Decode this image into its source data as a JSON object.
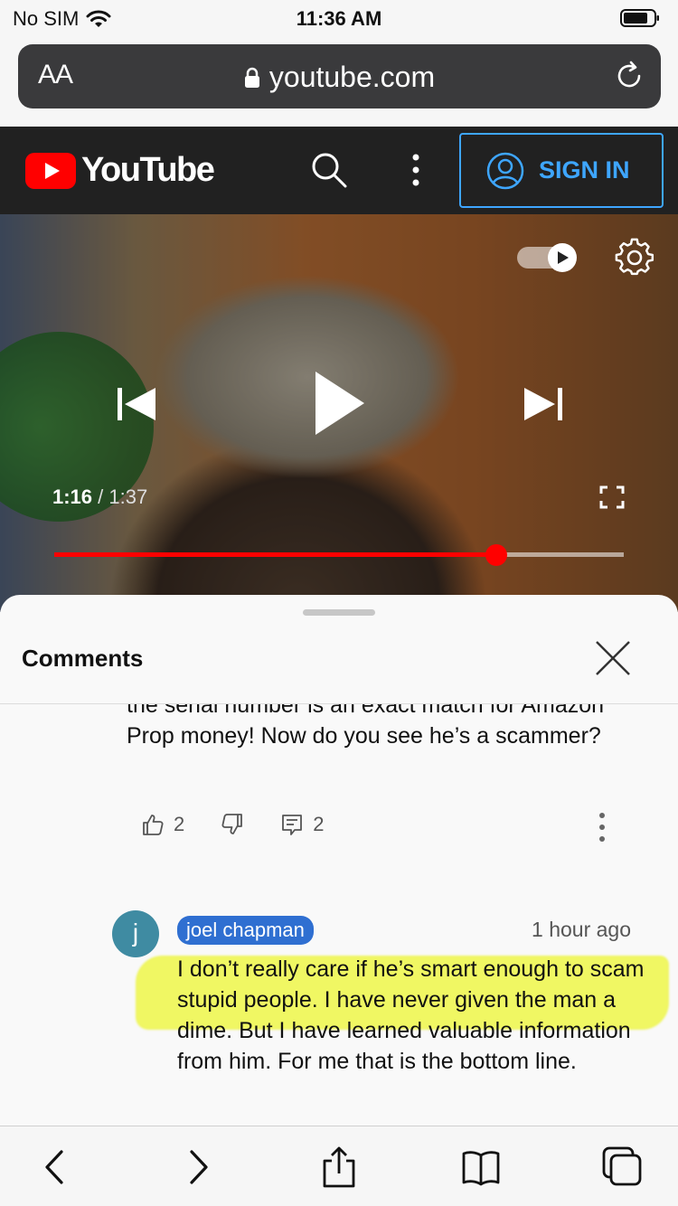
{
  "status_bar": {
    "carrier": "No SIM",
    "time": "11:36 AM"
  },
  "browser": {
    "text_size_label": "AA",
    "url": "youtube.com"
  },
  "header": {
    "logo_text": "YouTube",
    "sign_in_label": "SIGN IN"
  },
  "player": {
    "current_time": "1:16",
    "separator": "/",
    "duration": "1:37",
    "progress": 0.776
  },
  "comments": {
    "title": "Comments",
    "previous_comment": {
      "text": "the serial number is an exact match for Amazon Prop money! Now do you see he’s a scammer?",
      "likes": "2",
      "replies": "2"
    },
    "reply": {
      "avatar_letter": "j",
      "author": "joel chapman",
      "time": "1 hour ago",
      "text": "I don’t really care if he’s smart enough to scam stupid people. I have never given the man a dime. But I have learned valuable information from him. For me that is the bottom line."
    }
  },
  "colors": {
    "accent_red": "#ff0000",
    "link_blue": "#3ea6ff",
    "highlight": "#ecf528"
  }
}
